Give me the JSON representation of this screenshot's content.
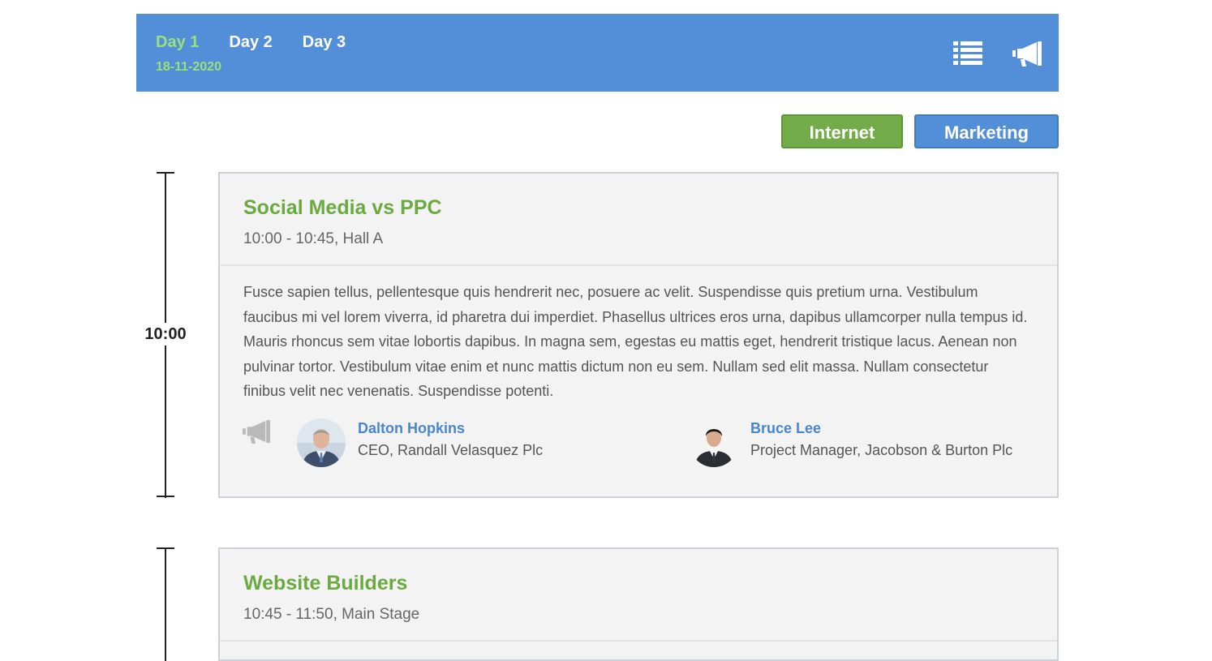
{
  "header": {
    "days": [
      "Day 1",
      "Day 2",
      "Day 3"
    ],
    "active_day": "Day 1",
    "date": "18-11-2020",
    "icons": [
      "list-icon",
      "megaphone-icon"
    ],
    "bg_color": "#538fd8",
    "active_color": "#9be07a"
  },
  "tags": {
    "internet": "Internet",
    "marketing": "Marketing",
    "internet_color": "#72ab48",
    "marketing_color": "#538fd8"
  },
  "timeline": {
    "first_time": "10:00"
  },
  "sessions": [
    {
      "title": "Social Media vs PPC",
      "meta": "10:00 - 10:45, Hall A",
      "description": "Fusce sapien tellus, pellentesque quis hendrerit nec, posuere ac velit. Suspendisse quis pretium urna. Vestibulum faucibus mi vel lorem viverra, id pharetra dui imperdiet. Phasellus ultrices eros urna, dapibus ullamcorper nulla tempus id. Mauris rhoncus sem vitae lobortis dapibus. In magna sem, egestas eu mattis eget, hendrerit tristique lacus. Aenean non pulvinar tortor. Vestibulum vitae enim et nunc mattis dictum non eu sem. Nullam sed elit massa. Nullam consectetur finibus velit nec venenatis. Suspendisse potenti.",
      "speakers": [
        {
          "name": "Dalton Hopkins",
          "role": "CEO, Randall Velasquez Plc"
        },
        {
          "name": "Bruce Lee",
          "role": "Project Manager, Jacobson & Burton Plc"
        }
      ]
    },
    {
      "title": "Website Builders",
      "meta": "10:45 - 11:50, Main Stage"
    }
  ]
}
